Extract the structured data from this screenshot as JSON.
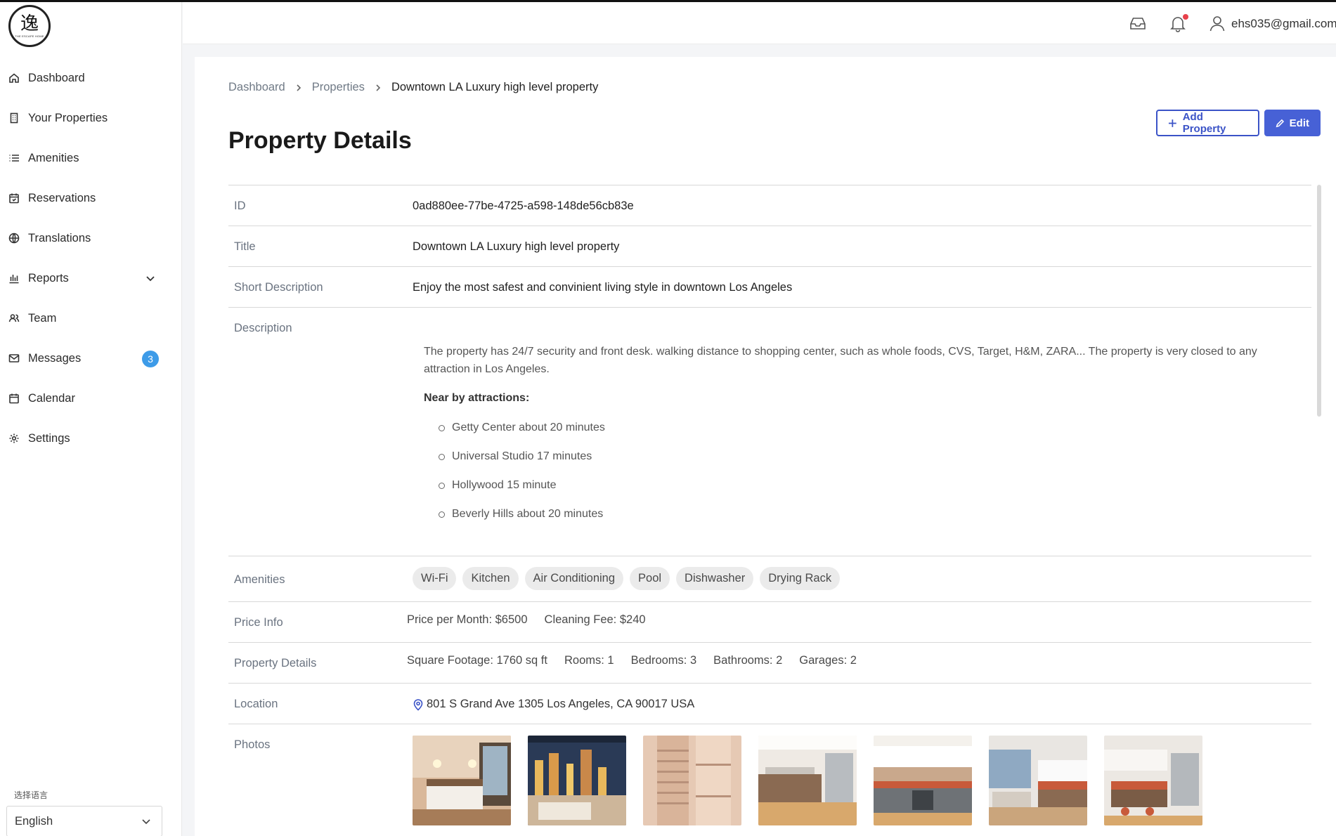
{
  "sidebar": {
    "logo_glyph": "逸",
    "logo_text": "THE ESCAPE HOME",
    "items": [
      {
        "label": "Dashboard",
        "icon": "home-icon"
      },
      {
        "label": "Your Properties",
        "icon": "building-icon"
      },
      {
        "label": "Amenities",
        "icon": "list-icon"
      },
      {
        "label": "Reservations",
        "icon": "calendar-check-icon"
      },
      {
        "label": "Translations",
        "icon": "globe-icon"
      },
      {
        "label": "Reports",
        "icon": "bar-chart-icon"
      },
      {
        "label": "Team",
        "icon": "users-icon"
      },
      {
        "label": "Messages",
        "icon": "mail-icon",
        "badge": "3"
      },
      {
        "label": "Calendar",
        "icon": "calendar-icon"
      },
      {
        "label": "Settings",
        "icon": "gear-icon"
      }
    ],
    "language_label": "选择语言",
    "language_value": "English"
  },
  "header": {
    "user_email": "ehs035@gmail.com"
  },
  "breadcrumb": [
    "Dashboard",
    "Properties",
    "Downtown LA Luxury high level property"
  ],
  "page_title": "Property Details",
  "buttons": {
    "add_property": "Add Property",
    "edit": "Edit"
  },
  "details": {
    "id": {
      "label": "ID",
      "value": "0ad880ee-77be-4725-a598-148de56cb83e"
    },
    "title": {
      "label": "Title",
      "value": "Downtown LA Luxury high level property"
    },
    "short_description": {
      "label": "Short Description",
      "value": "Enjoy the most safest and convinient living style in downtown Los Angeles"
    },
    "description": {
      "label": "Description",
      "paragraph": "The property has 24/7 security and front desk. walking distance to shopping center, such as whole foods, CVS, Target, H&M, ZARA... The property is very closed to any attraction in Los Angeles.",
      "nearby_heading": "Near by attractions:",
      "nearby": [
        "Getty Center about 20 minutes",
        "Universal Studio 17 minutes",
        "Hollywood 15 minute",
        "Beverly Hills about 20 minutes"
      ]
    },
    "amenities": {
      "label": "Amenities",
      "items": [
        "Wi-Fi",
        "Kitchen",
        "Air Conditioning",
        "Pool",
        "Dishwasher",
        "Drying Rack"
      ]
    },
    "price_info": {
      "label": "Price Info",
      "items": [
        "Price per Month:  $6500",
        "Cleaning Fee:  $240"
      ]
    },
    "property_details": {
      "label": "Property Details",
      "items": [
        "Square Footage:  1760 sq ft",
        "Rooms:  1",
        "Bedrooms:  3",
        "Bathrooms:  2",
        "Garages:  2"
      ]
    },
    "location": {
      "label": "Location",
      "value": "801 S Grand Ave 1305 Los Angeles, CA 90017 USA"
    },
    "photos": {
      "label": "Photos",
      "items": [
        "bedroom",
        "city-view-living-room",
        "closet-shelving",
        "kitchen",
        "kitchen-counter",
        "living-room-kitchen",
        "kitchen-island"
      ]
    }
  },
  "colors": {
    "accent": "#3b53c7",
    "badge": "#3d9be8",
    "notification": "#e8414b"
  }
}
